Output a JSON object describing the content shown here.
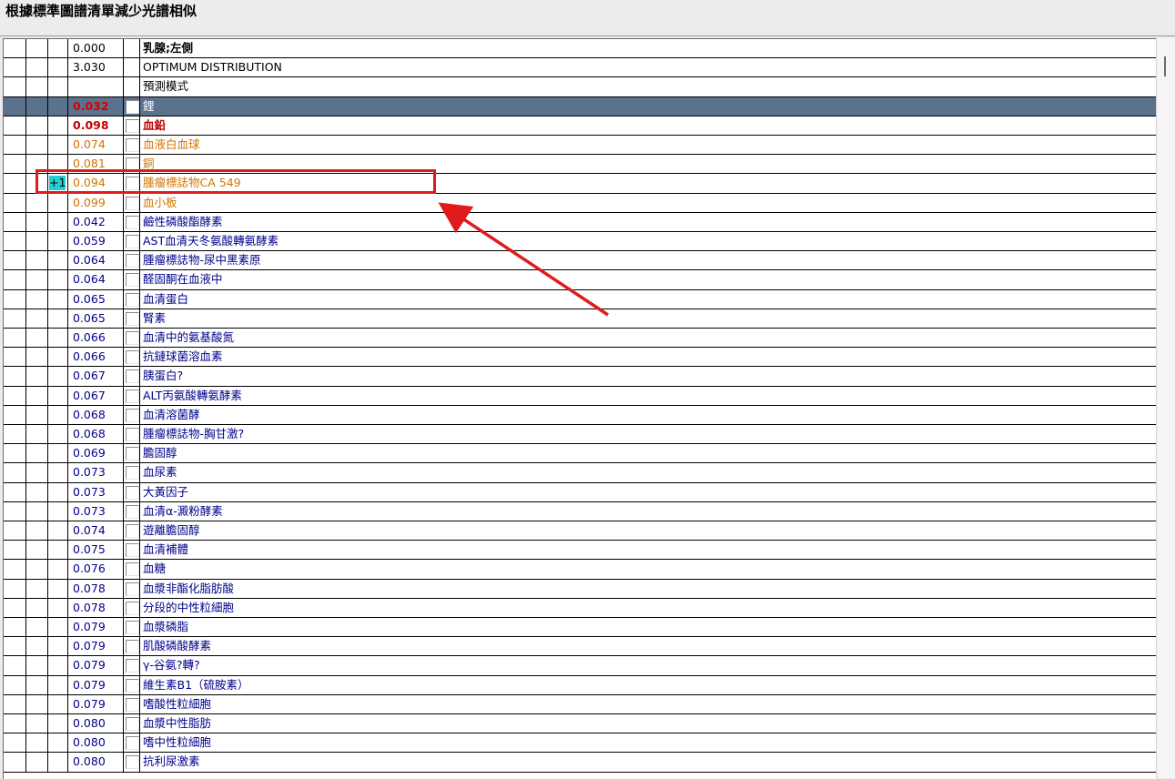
{
  "title": "根據標準圖譜清單減少光譜相似",
  "colors": {
    "selected_row": "#5b728f",
    "red": "#c00000",
    "orange": "#d27400",
    "blue": "#00008b",
    "delta_badge": "#21cfd5",
    "annotation": "#e11b1b"
  },
  "annotation": {
    "target_row": "腫瘤標誌物CA 549"
  },
  "rows": [
    {
      "value": "0.000",
      "name": "乳腺;左側",
      "style": "black bold",
      "checkbox": false
    },
    {
      "value": "3.030",
      "name": "OPTIMUM DISTRIBUTION",
      "style": "black",
      "checkbox": false
    },
    {
      "value": "",
      "name": "預測模式",
      "style": "black",
      "checkbox": false
    },
    {
      "value": "0.032",
      "name": "鋰",
      "style": "sel red",
      "checkbox": true
    },
    {
      "value": "0.098",
      "name": "血鉛",
      "style": "red",
      "checkbox": true
    },
    {
      "value": "0.074",
      "name": "血液白血球",
      "style": "orange",
      "checkbox": true
    },
    {
      "value": "0.081",
      "name": "銅",
      "style": "orange",
      "checkbox": true
    },
    {
      "value": "0.094",
      "name": "腫瘤標誌物CA 549",
      "style": "orange",
      "checkbox": true,
      "delta": "+1"
    },
    {
      "value": "0.099",
      "name": "血小板",
      "style": "orange",
      "checkbox": true
    },
    {
      "value": "0.042",
      "name": "鹼性磷酸酯酵素",
      "style": "",
      "checkbox": true
    },
    {
      "value": "0.059",
      "name": "AST血清天冬氨酸轉氨酵素",
      "style": "",
      "checkbox": true
    },
    {
      "value": "0.064",
      "name": "腫瘤標誌物-尿中黑素原",
      "style": "",
      "checkbox": true
    },
    {
      "value": "0.064",
      "name": "醛固酮在血液中",
      "style": "",
      "checkbox": true
    },
    {
      "value": "0.065",
      "name": "血清蛋白",
      "style": "",
      "checkbox": true
    },
    {
      "value": "0.065",
      "name": "腎素",
      "style": "",
      "checkbox": true
    },
    {
      "value": "0.066",
      "name": "血清中的氨基酸氮",
      "style": "",
      "checkbox": true
    },
    {
      "value": "0.066",
      "name": "抗鏈球菌溶血素",
      "style": "",
      "checkbox": true
    },
    {
      "value": "0.067",
      "name": "胰蛋白?",
      "style": "",
      "checkbox": true
    },
    {
      "value": "0.067",
      "name": "ALT丙氨酸轉氨酵素",
      "style": "",
      "checkbox": true
    },
    {
      "value": "0.068",
      "name": "血清溶菌酵",
      "style": "",
      "checkbox": true
    },
    {
      "value": "0.068",
      "name": "腫瘤標誌物-胸甘激?",
      "style": "",
      "checkbox": true
    },
    {
      "value": "0.069",
      "name": "膽固醇",
      "style": "",
      "checkbox": true
    },
    {
      "value": "0.073",
      "name": "血尿素",
      "style": "",
      "checkbox": true
    },
    {
      "value": "0.073",
      "name": "大黃因子",
      "style": "",
      "checkbox": true
    },
    {
      "value": "0.073",
      "name": "血清α-澱粉酵素",
      "style": "",
      "checkbox": true
    },
    {
      "value": "0.074",
      "name": "遊離膽固醇",
      "style": "",
      "checkbox": true
    },
    {
      "value": "0.075",
      "name": "血清補體",
      "style": "",
      "checkbox": true
    },
    {
      "value": "0.076",
      "name": "血糖",
      "style": "",
      "checkbox": true
    },
    {
      "value": "0.078",
      "name": "血漿非酯化脂肪酸",
      "style": "",
      "checkbox": true
    },
    {
      "value": "0.078",
      "name": "分段的中性粒細胞",
      "style": "",
      "checkbox": true
    },
    {
      "value": "0.079",
      "name": "血漿磷脂",
      "style": "",
      "checkbox": true
    },
    {
      "value": "0.079",
      "name": "肌酸磷酸酵素",
      "style": "",
      "checkbox": true
    },
    {
      "value": "0.079",
      "name": "γ-谷氨?轉?",
      "style": "",
      "checkbox": true
    },
    {
      "value": "0.079",
      "name": "維生素B1（硫胺素）",
      "style": "",
      "checkbox": true
    },
    {
      "value": "0.079",
      "name": "嗜酸性粒細胞",
      "style": "",
      "checkbox": true
    },
    {
      "value": "0.080",
      "name": "血漿中性脂肪",
      "style": "",
      "checkbox": true
    },
    {
      "value": "0.080",
      "name": "嗜中性粒細胞",
      "style": "",
      "checkbox": true
    },
    {
      "value": "0.080",
      "name": "抗利尿激素",
      "style": "",
      "checkbox": true
    }
  ]
}
